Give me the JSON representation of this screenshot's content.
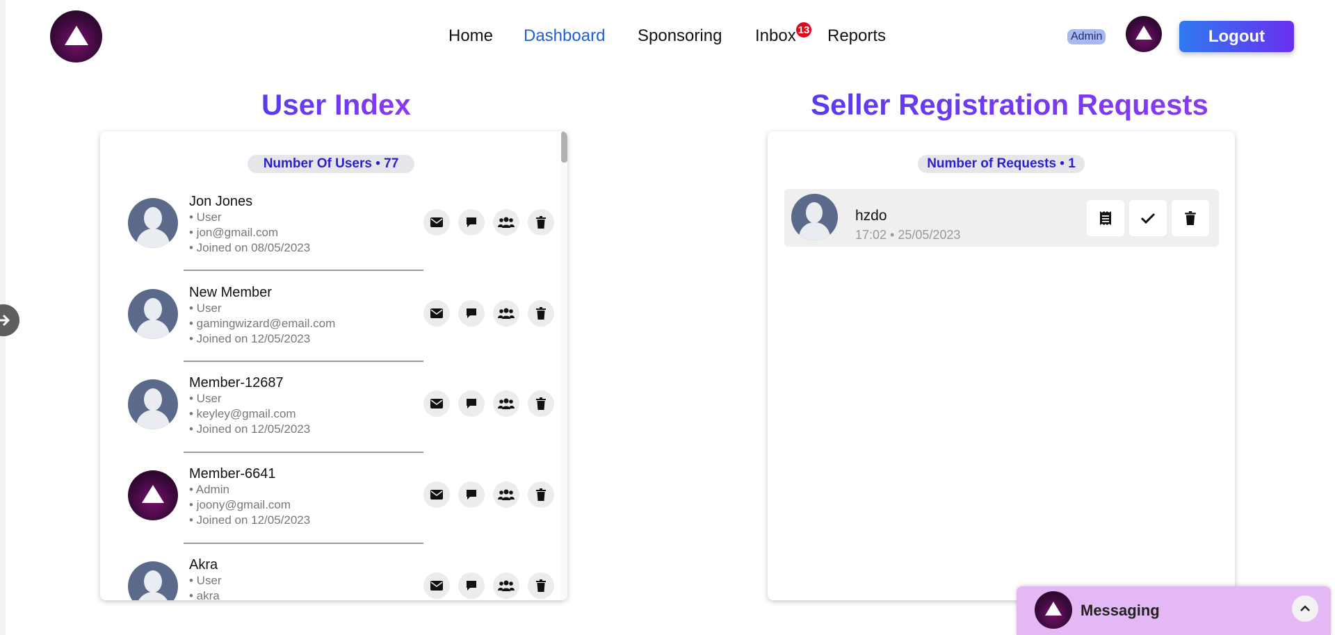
{
  "nav": {
    "items": [
      {
        "label": "Home",
        "active": false
      },
      {
        "label": "Dashboard",
        "active": true
      },
      {
        "label": "Sponsoring",
        "active": false
      },
      {
        "label": "Inbox",
        "active": false,
        "badge": "13"
      },
      {
        "label": "Reports",
        "active": false
      }
    ],
    "role_badge": "Admin",
    "logout_label": "Logout"
  },
  "user_index": {
    "title": "User Index",
    "count_label": "Number Of Users • 77",
    "users": [
      {
        "name": "Jon Jones",
        "role": "• User",
        "email": "• jon@gmail.com",
        "joined": "• Joined on  08/05/2023",
        "avatar": "default"
      },
      {
        "name": "New Member",
        "role": "• User",
        "email": "• gamingwizard@email.com",
        "joined": "• Joined on  12/05/2023",
        "avatar": "default"
      },
      {
        "name": "Member-12687",
        "role": "• User",
        "email": "• keyley@gmail.com",
        "joined": "• Joined on  12/05/2023",
        "avatar": "default"
      },
      {
        "name": "Member-6641",
        "role": "• Admin",
        "email": "• joony@gmail.com",
        "joined": "• Joined on  12/05/2023",
        "avatar": "logo"
      },
      {
        "name": "Akra",
        "role": "• User",
        "email": "• akra",
        "joined": "",
        "avatar": "default"
      }
    ],
    "row_actions": [
      "envelope-icon",
      "chat-bubble-icon",
      "users-group-icon",
      "trash-icon"
    ]
  },
  "seller_requests": {
    "title": "Seller Registration Requests",
    "count_label": "Number of Requests • 1",
    "requests": [
      {
        "name": "hzdo",
        "time": "17:02 • 25/05/2023"
      }
    ],
    "row_actions": [
      "receipt-icon",
      "check-icon",
      "trash-icon"
    ]
  },
  "messaging": {
    "label": "Messaging"
  },
  "colors": {
    "accent_blue": "#1f5fd1",
    "title_gradient_start": "#5a3af0",
    "title_gradient_end": "#8a3af0",
    "badge_red": "#e3061a",
    "count_text": "#2a1fd0",
    "messaging_bg": "#e3b8f4"
  }
}
